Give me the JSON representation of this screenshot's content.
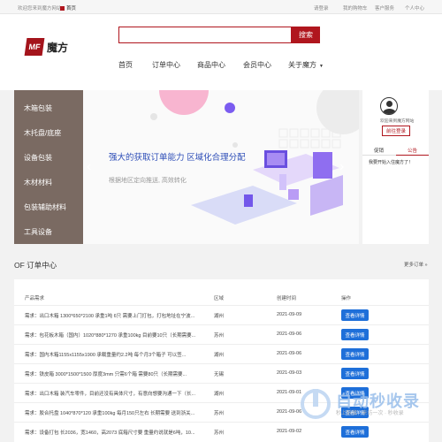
{
  "topbar": {
    "welcome": "欢迎您来到魔方网站!",
    "home": "首页",
    "links": [
      "请登录",
      "我的购物车",
      "客户服务",
      "个人中心"
    ]
  },
  "header": {
    "logo_mark": "MF",
    "logo_text": "魔方",
    "search_placeholder": "",
    "search_button": "搜索",
    "nav": [
      "首页",
      "订单中心",
      "商品中心",
      "会员中心",
      "关于魔方"
    ]
  },
  "sidebar": {
    "items": [
      "木箱包装",
      "木托盘/底座",
      "设备包装",
      "木材材料",
      "包装辅助材料",
      "工具设备"
    ]
  },
  "banner": {
    "slogan": "强大的获取订单能力 区域化合理分配",
    "subslogan": "根据地区定向推送, 高效转化"
  },
  "userbox": {
    "welcome": "欢迎来到魔方网站",
    "login_button": "前往登录",
    "tabs": [
      "促销",
      "公告"
    ],
    "notice": "我要开始入住魔方了！"
  },
  "orders": {
    "title": "OF 订单中心",
    "more": "更多订单 »",
    "headers": [
      "产品需求",
      "区域",
      "创建时间",
      "操作"
    ],
    "detail_label": "查看详情",
    "rows": [
      [
        "需求：出口木箱 1300*650*2100 承重1吨 6只 需要上门打包，打包地址在宁波...",
        "湖州",
        "2021-09-09"
      ],
      [
        "需求：包花板木箱（国内）1020*880*1270 承重100kg 目前要10只（长期需要...",
        "苏州",
        "2021-09-06"
      ],
      [
        "需求：国内木箱1155x1155x1900 承载重量约2.2吨 每个月3个箱子 可以签...",
        "湖州",
        "2021-09-06"
      ],
      [
        "需求：铁皮箱 3000*1500*1500 厚度3mm 只需6个箱 需要80只（长期需要...",
        "无锡",
        "2021-09-03"
      ],
      [
        "需求：出口木箱 装汽车零件，目前还没有具体尺寸，有意向想要沟通一下（长...",
        "湖州",
        "2021-09-01"
      ],
      [
        "需求：胶合托盘 1040*870*120 承重100kg 每月150只左右 长期需要 送到浙关...",
        "苏州",
        "2021-09-06"
      ],
      [
        "需求：设备打包 长2036，宽1460，高2073 底箱尺寸要 重量约说就是6吨，10...",
        "苏州",
        "2021-09-02"
      ]
    ]
  },
  "watermark": {
    "text": "自动秒收录",
    "sub": "秒上链接 · 来访一次 · 秒收录"
  },
  "colors": {
    "brand_red": "#b0161e",
    "sidebar_bg": "#7a6a62",
    "button_blue": "#1e6fd9",
    "slogan_blue": "#2f4fb8"
  }
}
